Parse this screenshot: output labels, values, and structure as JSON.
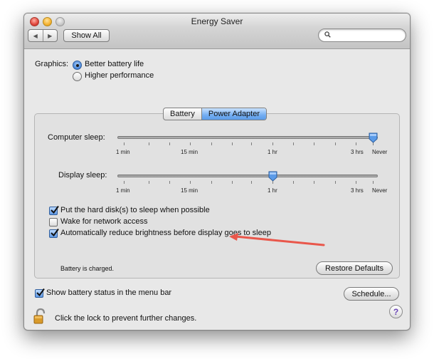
{
  "window": {
    "title": "Energy Saver"
  },
  "toolbar": {
    "back_icon": "back-arrow-icon",
    "forward_icon": "forward-arrow-icon",
    "show_all_label": "Show All",
    "search_placeholder": "",
    "search_icon": "magnifier-icon"
  },
  "graphics": {
    "label": "Graphics:",
    "options": [
      {
        "label": "Better battery life",
        "selected": true
      },
      {
        "label": "Higher performance",
        "selected": false
      }
    ]
  },
  "tabs": [
    {
      "label": "Battery",
      "selected": false
    },
    {
      "label": "Power Adapter",
      "selected": true
    }
  ],
  "computer_sleep": {
    "label": "Computer sleep:",
    "value": "Never",
    "tick_labels": [
      "1 min",
      "15 min",
      "1 hr",
      "3 hrs",
      "Never"
    ]
  },
  "display_sleep": {
    "label": "Display sleep:",
    "value": "1 hr",
    "tick_labels": [
      "1 min",
      "15 min",
      "1 hr",
      "3 hrs",
      "Never"
    ]
  },
  "options": [
    {
      "label": "Put the hard disk(s) to sleep when possible",
      "checked": true
    },
    {
      "label": "Wake for network access",
      "checked": false
    },
    {
      "label": "Automatically reduce brightness before display goes to sleep",
      "checked": true
    }
  ],
  "battery_status": "Battery is charged.",
  "restore_defaults_label": "Restore Defaults",
  "show_battery_status": {
    "label": "Show battery status in the menu bar",
    "checked": true
  },
  "schedule_label": "Schedule...",
  "lock_text": "Click the lock to prevent further changes.",
  "help_label": "?",
  "colors": {
    "annotation_arrow": "#e9574b",
    "selected_tab": "#74aef2"
  }
}
